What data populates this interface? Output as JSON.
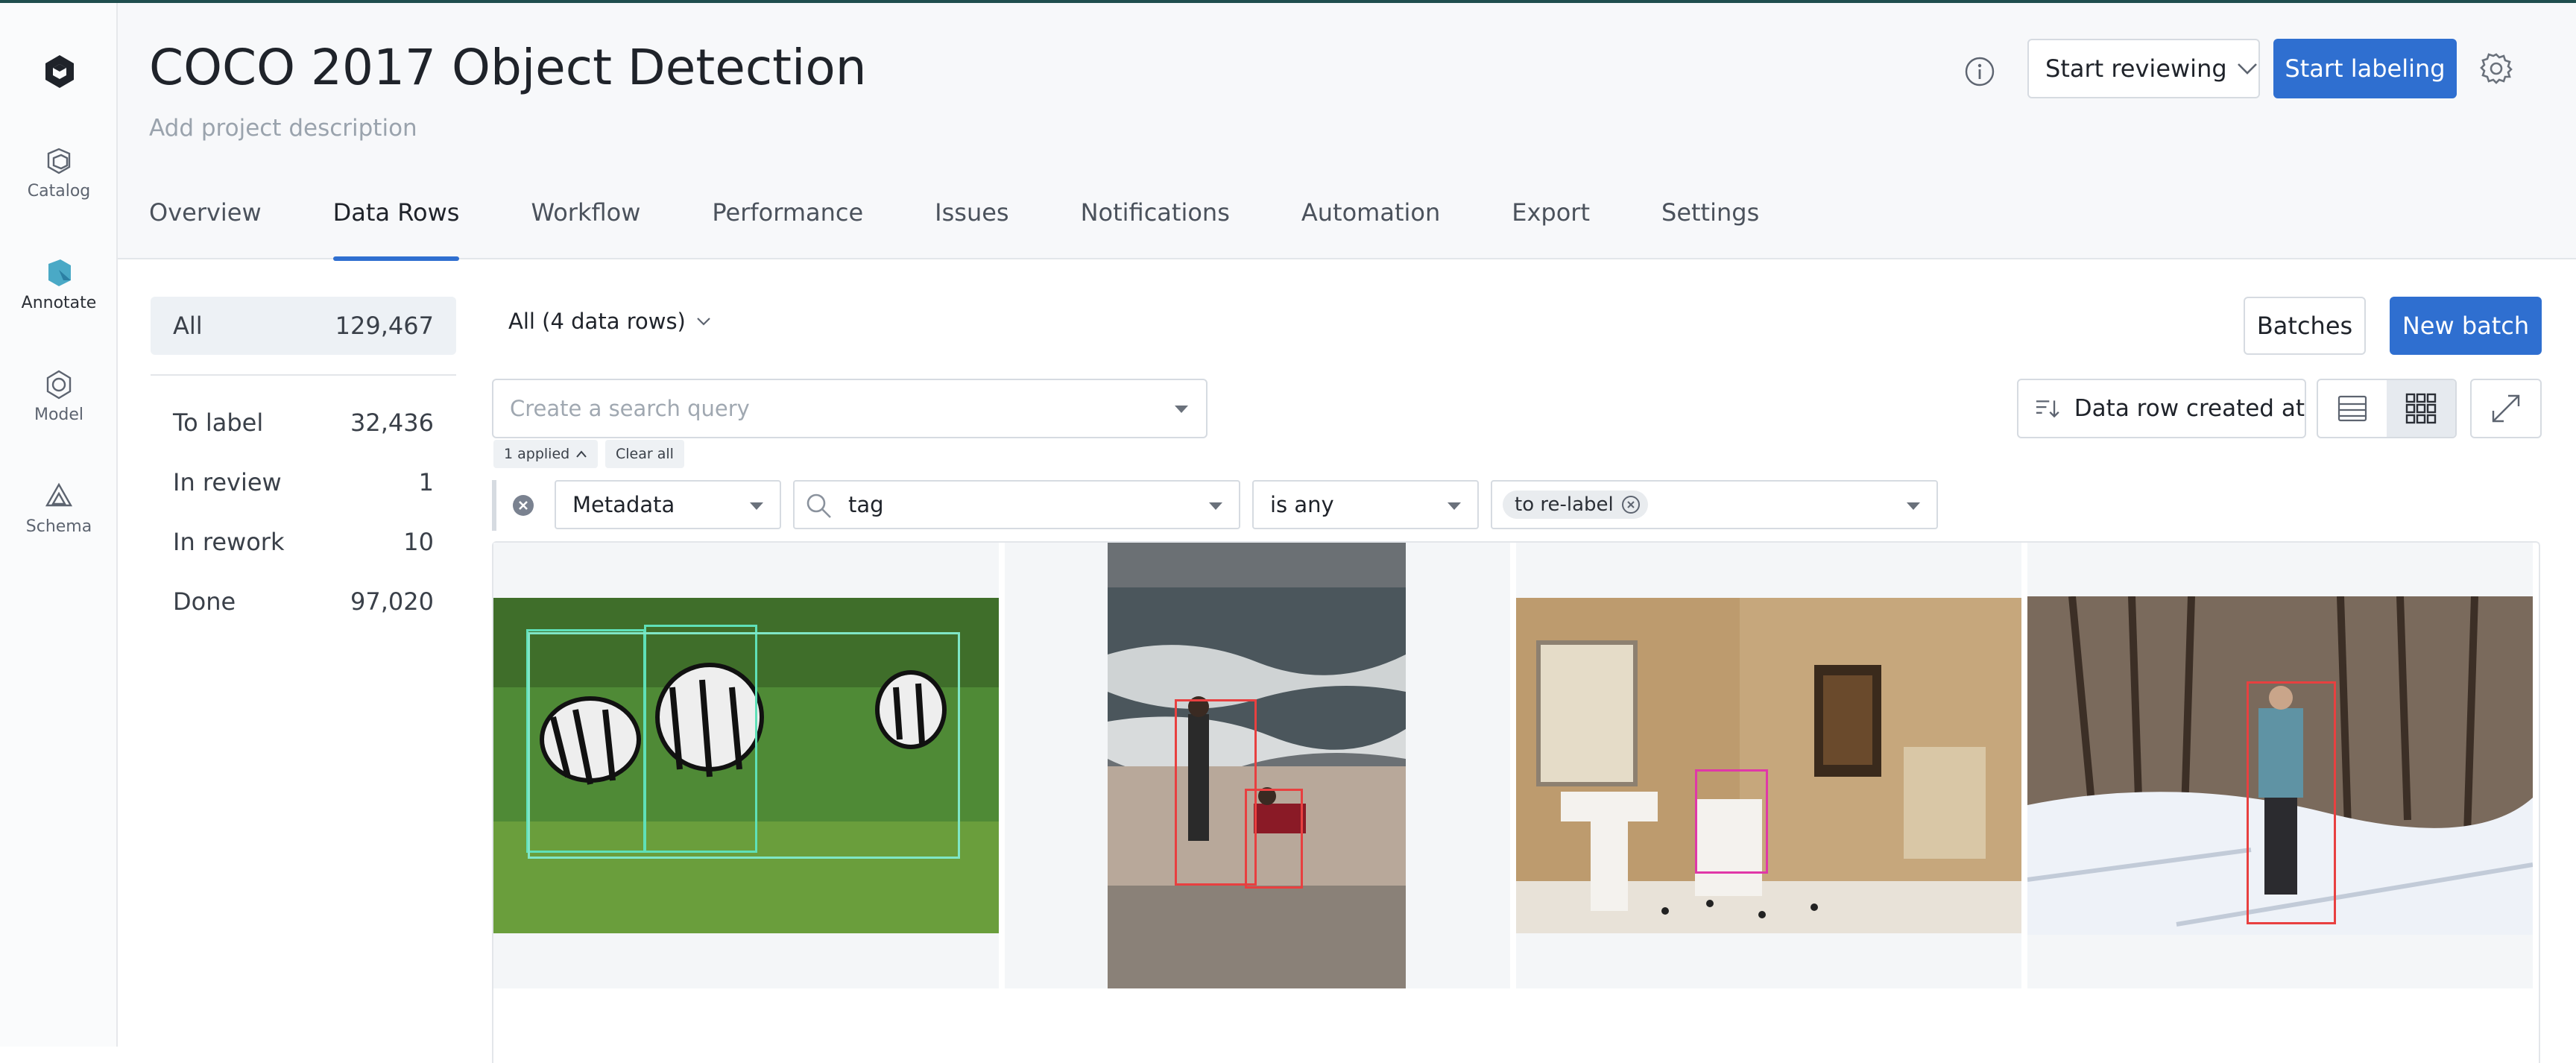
{
  "app": {
    "accent": "#2f6fd0"
  },
  "nav": [
    {
      "label": "Catalog",
      "icon": "catalog-icon"
    },
    {
      "label": "Annotate",
      "icon": "annotate-icon",
      "active": true
    },
    {
      "label": "Model",
      "icon": "model-icon"
    },
    {
      "label": "Schema",
      "icon": "schema-icon"
    }
  ],
  "header": {
    "title": "COCO 2017 Object Detection",
    "description": "Add project description",
    "start_reviewing": "Start reviewing",
    "start_labeling": "Start labeling"
  },
  "tabs": [
    {
      "label": "Overview"
    },
    {
      "label": "Data Rows",
      "active": true
    },
    {
      "label": "Workflow"
    },
    {
      "label": "Performance"
    },
    {
      "label": "Issues"
    },
    {
      "label": "Notifications"
    },
    {
      "label": "Automation"
    },
    {
      "label": "Export"
    },
    {
      "label": "Settings"
    }
  ],
  "stats": [
    {
      "label": "All",
      "value": "129,467",
      "selected": true
    },
    {
      "label": "To label",
      "value": "32,436"
    },
    {
      "label": "In review",
      "value": "1"
    },
    {
      "label": "In rework",
      "value": "10"
    },
    {
      "label": "Done",
      "value": "97,020"
    }
  ],
  "toolbar": {
    "all_rows": "All (4 data rows)",
    "batches": "Batches",
    "new_batch": "New batch",
    "search_placeholder": "Create a search query",
    "applied": "1 applied",
    "clear_all": "Clear all",
    "sort": "Data row created at"
  },
  "filter": {
    "field": "Metadata",
    "key": "tag",
    "operator": "is any",
    "value": "to re-label"
  },
  "thumbnails": [
    {
      "scene": "zebras grazing"
    },
    {
      "scene": "people on beach"
    },
    {
      "scene": "bathroom"
    },
    {
      "scene": "skier in snowy woods"
    }
  ]
}
